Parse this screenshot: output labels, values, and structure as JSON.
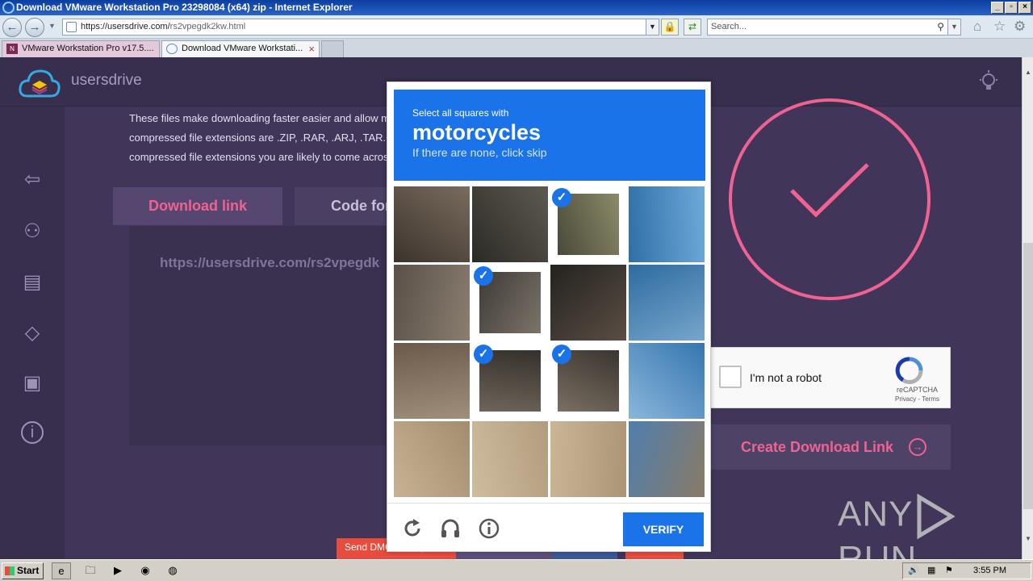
{
  "browser": {
    "window_title": "Download VMware Workstation Pro 23298084 (x64) zip - Internet Explorer",
    "address_url_host": "https://usersdrive.com/",
    "address_url_path": "rs2vpegdk2kw.html",
    "search_placeholder": "Search...",
    "tabs": [
      {
        "label": "VMware Workstation Pro v17.5...."
      },
      {
        "label": "Download VMware Workstati..."
      }
    ]
  },
  "site": {
    "brand": "usersdrive",
    "paragraph_lines": [
      "These files make downloading faster easier and allow m",
      "compressed file extensions are .ZIP, .RAR, .ARJ, .TAR.GZ",
      "compressed file extensions you are likely to come acros"
    ],
    "download_link_button": "Download link",
    "code_button": "Code for",
    "download_url": "https://usersdrive.com/rs2vpegdk",
    "create_link_button": "Create Download Link",
    "footer_buttons": [
      "Send DMCA Complaint",
      "",
      "",
      ""
    ]
  },
  "recaptcha_checkbox": {
    "label": "I'm not a robot",
    "brand": "reCAPTCHA",
    "terms": "Privacy - Terms"
  },
  "captcha": {
    "instruction": "Select all squares with",
    "object": "motorcycles",
    "hint": "If there are none, click skip",
    "verify_label": "VERIFY",
    "tiles": [
      {
        "selected": false
      },
      {
        "selected": false
      },
      {
        "selected": true
      },
      {
        "selected": false
      },
      {
        "selected": false
      },
      {
        "selected": true
      },
      {
        "selected": false
      },
      {
        "selected": false
      },
      {
        "selected": false
      },
      {
        "selected": true
      },
      {
        "selected": true
      },
      {
        "selected": false
      },
      {
        "selected": false
      },
      {
        "selected": false
      },
      {
        "selected": false
      },
      {
        "selected": false
      }
    ]
  },
  "watermark": {
    "left": "ANY",
    "right": "RUN"
  },
  "taskbar": {
    "start_label": "Start",
    "clock": "3:55 PM"
  },
  "colors": {
    "accent_pink": "#f06292",
    "captcha_blue": "#1a73e8",
    "page_bg": "#3c3251"
  }
}
